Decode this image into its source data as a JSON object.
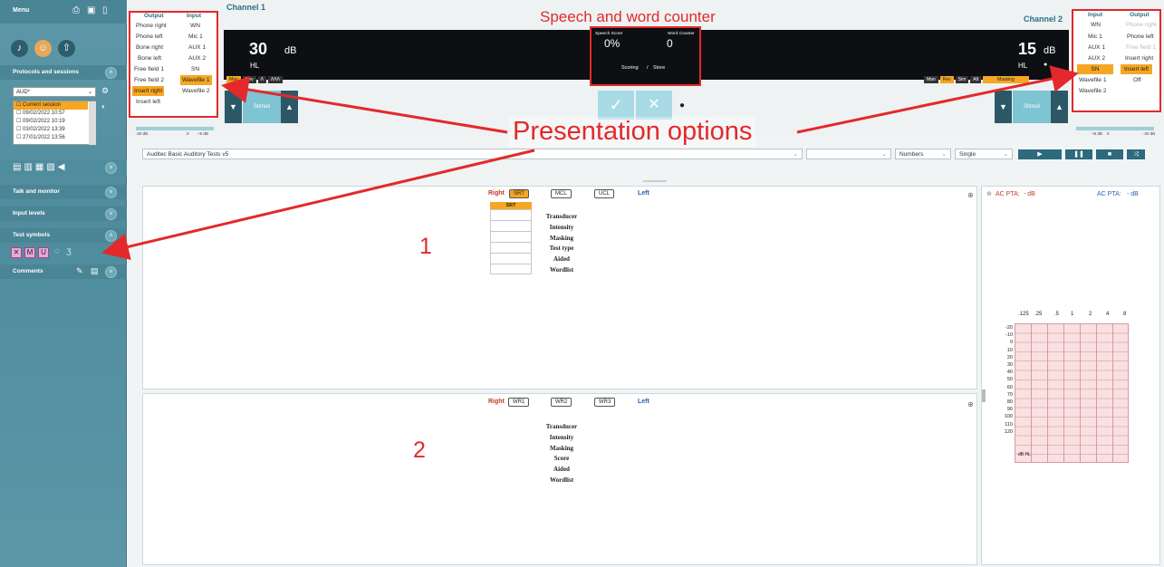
{
  "sidebar": {
    "menu_label": "Menu",
    "protocols_label": "Protocols and sessions",
    "protocol_value": "AUD*",
    "sessions": [
      "Current session",
      "09/02/2022 10:57",
      "09/02/2022 10:19",
      "03/02/2022 13:39",
      "27/01/2022 13:56"
    ],
    "talk_label": "Talk and monitor",
    "input_levels_label": "Input levels",
    "test_symbols_label": "Test symbols",
    "comments_label": "Comments"
  },
  "channel1": {
    "title": "Channel 1",
    "level": "30",
    "unit": "dB",
    "hl": "HL",
    "segments": [
      "Man",
      "Rev",
      "Λ",
      "ΛΛΛ"
    ],
    "output_header": "Output",
    "input_header": "Input",
    "outputs": [
      "Phone right",
      "Phone left",
      "Bone right",
      "Bone left",
      "Free field 1",
      "Free field 2",
      "Insert right",
      "Insert left"
    ],
    "inputs": [
      "WN",
      "Mic 1",
      "AUX 1",
      "AUX 2",
      "SN",
      "Wavefile 1",
      "Wavefile 2"
    ],
    "stimuli": "Stimuli",
    "slider_min": "-20 dB",
    "slider_mid": "0",
    "slider_max": "+5 dB"
  },
  "channel2": {
    "title": "Channel 2",
    "level": "15",
    "unit": "dB",
    "hl": "HL",
    "segments": [
      "Man",
      "Rev",
      "Sim",
      "Alt",
      "Masking"
    ],
    "input_header": "Input",
    "output_header": "Output",
    "inputs": [
      "WN",
      "Mic 1",
      "AUX 1",
      "AUX 2",
      "SN",
      "Wavefile 1",
      "Wavefile 2"
    ],
    "outputs": [
      "Phone right",
      "Phone left",
      "Free field 1",
      "Insert right",
      "Insert left",
      "Off"
    ],
    "stimuli": "Stimuli",
    "slider_max_l": "+5 dB",
    "slider_mid": "0",
    "slider_max": "-20 dB"
  },
  "counter": {
    "speech_score_label": "Speech Score",
    "speech_score": "0%",
    "word_counter_label": "Word Counter",
    "word_counter": "0",
    "scoring": "Scoring",
    "store": "Store",
    "slash": "/"
  },
  "annotations": {
    "speech_counter": "Speech and word counter",
    "presentation": "Presentation options",
    "one": "1",
    "two": "2"
  },
  "toolbar": {
    "test_list": "Auditec Basic Auditory Tests v5",
    "material": "Numbers",
    "mode": "Single"
  },
  "panel1": {
    "right": "Right",
    "left": "Left",
    "tabs": [
      "SRT",
      "MCL",
      "UCL"
    ],
    "col_header": "SRT",
    "labels": [
      "Transducer",
      "Intensity",
      "Masking",
      "Test type",
      "Aided",
      "Wordlist"
    ]
  },
  "panel2": {
    "right": "Right",
    "left": "Left",
    "tabs": [
      "WR1",
      "WR2",
      "WR3"
    ],
    "labels": [
      "Transducer",
      "Intensity",
      "Masking",
      "Score",
      "Aided",
      "Wordlist"
    ]
  },
  "audiogram": {
    "pta1_label": "AC PTA:",
    "pta1_value": "- dB",
    "pta2_label": "AC PTA:",
    "pta2_value": "- dB",
    "freqs": [
      ".125",
      ".25",
      ".5",
      "1",
      "2",
      "4",
      "8"
    ],
    "khz": "kHz",
    "levels": [
      "-20",
      "-10",
      "0",
      "10",
      "20",
      "30",
      "40",
      "50",
      "60",
      "70",
      "80",
      "90",
      "100",
      "110",
      "120"
    ],
    "unit": "dB HL"
  },
  "colors": {
    "accent": "#f5a623",
    "annotation": "#e3292b",
    "teal": "#2b6e84"
  }
}
